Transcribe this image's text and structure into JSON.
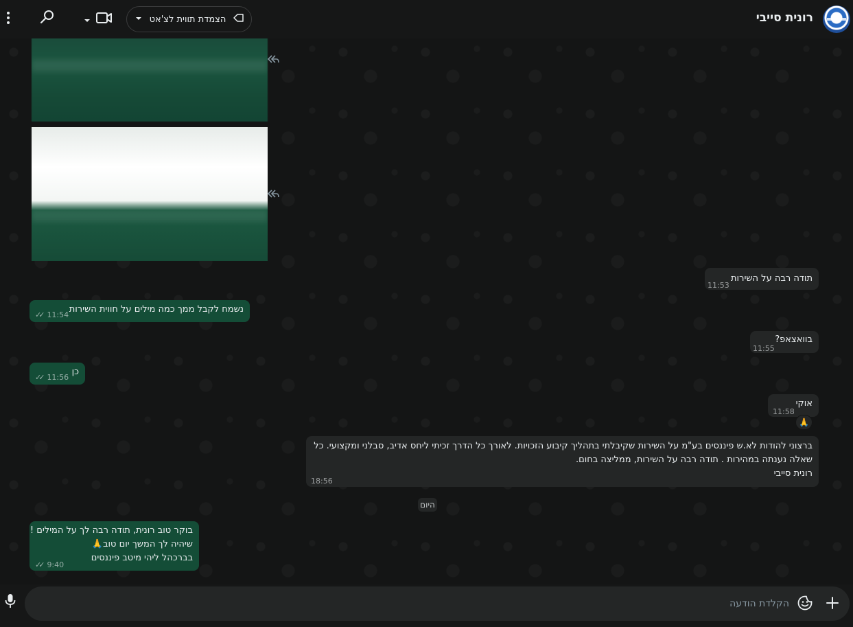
{
  "header": {
    "contact_name": "רונית סייבי",
    "label_button": "הצמדת תווית לצ'אט",
    "icons": [
      "avatar",
      "label-icon",
      "chevron-down-icon",
      "video-call-icon",
      "search-icon",
      "menu-icon"
    ]
  },
  "messages": [
    {
      "id": "m1",
      "direction": "in",
      "text": "תודה רבה על השירות",
      "time": "11:53"
    },
    {
      "id": "m2",
      "direction": "out",
      "text": "נשמח לקבל ממך כמה מילים על חווית השירות",
      "time": "11:54",
      "status": "read"
    },
    {
      "id": "m3",
      "direction": "in",
      "text": "בוואצאפ?",
      "time": "11:55"
    },
    {
      "id": "m4",
      "direction": "out",
      "text": "כן",
      "time": "11:56",
      "status": "read"
    },
    {
      "id": "m5",
      "direction": "in",
      "text": "אוקי",
      "time": "11:58",
      "reaction": "🙏"
    },
    {
      "id": "m6",
      "direction": "in",
      "lines": [
        "ברצוני להודות לא.ש פיננסים בע\"מ על השירות שקיבלתי בתהליך קיבוע הזכויות. לאורך כל הדרך זכיתי ליחס אדיב, סבלני ומקצועי. כל",
        "שאלה נענתה במהירות . תודה רבה על השירות, ממליצה בחום.",
        "רונית סייבי"
      ],
      "time": "18:56"
    },
    {
      "id": "m7",
      "direction": "out",
      "lines": [
        "בוקר טוב רונית, תודה רבה לך על המילים !",
        "שיהיה לך המשך יום טוב🙏",
        "בברכהל ליהי מיטב פיננסים"
      ],
      "time": "9:40",
      "status": "read"
    }
  ],
  "date_separator": "היום",
  "composer": {
    "placeholder": "הקלדת הודעה"
  },
  "colors": {
    "background": "#161717",
    "outgoing_bubble": "#144d37",
    "incoming_bubble": "#242626",
    "text": "#e9edef",
    "meta": "#8696a0"
  }
}
